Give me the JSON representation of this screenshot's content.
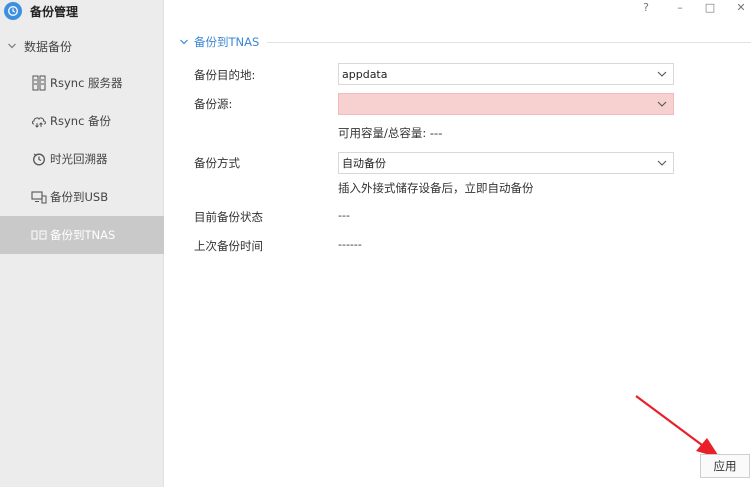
{
  "app": {
    "title": "备份管理",
    "icon": "backup-clock-icon"
  },
  "window_controls": [
    "?",
    "–",
    "□",
    "✕"
  ],
  "sidebar": {
    "group_label": "数据备份",
    "items": [
      {
        "label": "Rsync 服务器",
        "icon": "server-icon",
        "active": false
      },
      {
        "label": "Rsync 备份",
        "icon": "cloud-sync-icon",
        "active": false
      },
      {
        "label": "时光回溯器",
        "icon": "time-machine-icon",
        "active": false
      },
      {
        "label": "备份到USB",
        "icon": "usb-device-icon",
        "active": false
      },
      {
        "label": "备份到TNAS",
        "icon": "nas-icon",
        "active": true
      }
    ]
  },
  "main": {
    "section_title": "备份到TNAS",
    "fields": {
      "dest_label": "备份目的地:",
      "dest_value": "appdata",
      "source_label": "备份源:",
      "source_value": "",
      "capacity_text": "可用容量/总容量: ---",
      "mode_label": "备份方式",
      "mode_value": "自动备份",
      "mode_hint": "插入外接式储存设备后，立即自动备份",
      "status_label": "目前备份状态",
      "status_value": "---",
      "last_label": "上次备份时间",
      "last_value": "------"
    },
    "apply_label": "应用"
  },
  "colors": {
    "accent": "#3b87d4",
    "error_bg": "#f7d0d0",
    "annotation": "#e8202a"
  }
}
